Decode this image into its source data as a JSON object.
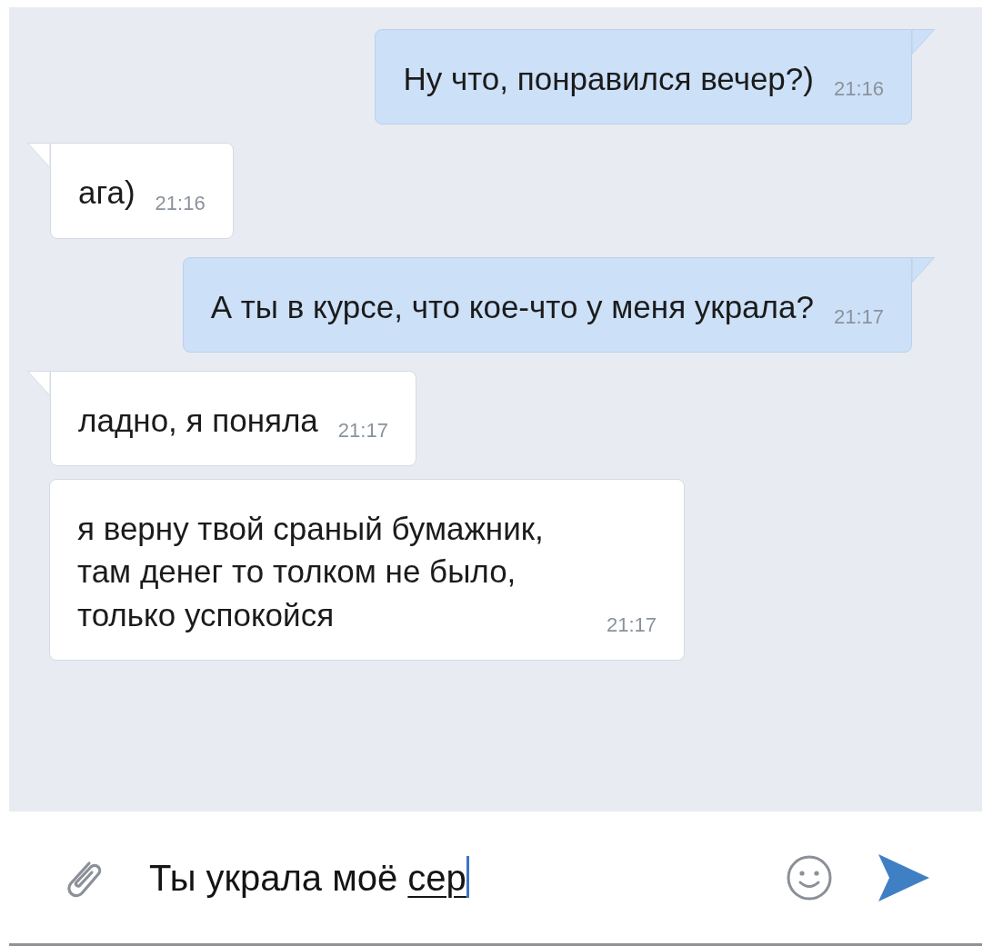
{
  "messages": [
    {
      "kind": "outgoing",
      "tail": true,
      "text": "Ну что, понравился вечер?)",
      "time": "21:16"
    },
    {
      "kind": "incoming",
      "tail": true,
      "text": "ага)",
      "time": "21:16"
    },
    {
      "kind": "outgoing",
      "tail": true,
      "text": "А ты в курсе, что кое-что у меня украла?",
      "time": "21:17"
    },
    {
      "kind": "incoming",
      "tail": true,
      "text": "ладно, я поняла",
      "time": "21:17"
    },
    {
      "kind": "incoming",
      "tail": false,
      "text": "я верну твой сраный бумажник, там денег то толком не было, только успокойся",
      "time": "21:17"
    }
  ],
  "composer": {
    "value": "Ты украла моё ",
    "composing": "сер"
  }
}
